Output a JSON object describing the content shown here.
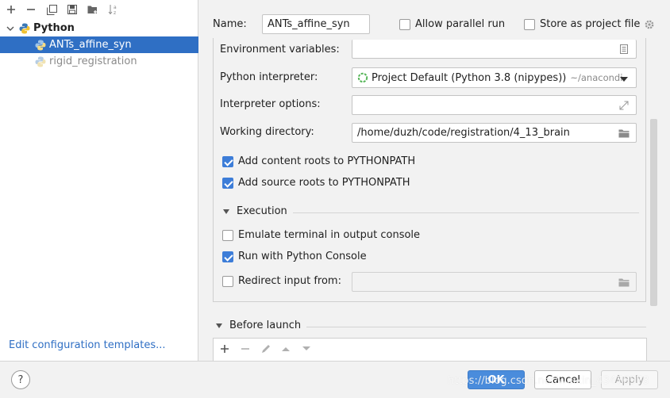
{
  "toolbar": {
    "add_icon": "plus-icon",
    "remove_icon": "minus-icon",
    "copy_icon": "copy-icon",
    "save_icon": "save-icon",
    "folder_icon": "new-folder-icon",
    "sort_icon": "sort-icon"
  },
  "tree": {
    "root_label": "Python",
    "items": [
      {
        "label": "ANTs_affine_syn",
        "selected": true
      },
      {
        "label": "rigid_registration",
        "selected": false
      }
    ]
  },
  "edit_templates_link": "Edit configuration templates...",
  "header": {
    "name_label": "Name:",
    "name_value": "ANTs_affine_syn",
    "allow_parallel_label": "Allow parallel run",
    "store_label": "Store as project file"
  },
  "config": {
    "env_label": "Environment variables:",
    "env_value": "",
    "interpreter_label": "Python interpreter:",
    "interpreter_value": "Project Default (Python 3.8 (nipypes))",
    "interpreter_path": "~/anacondi",
    "interp_options_label": "Interpreter options:",
    "interp_options_value": "",
    "workdir_label": "Working directory:",
    "workdir_value": "/home/duzh/code/registration/4_13_brain",
    "add_content_roots": "Add content roots to PYTHONPATH",
    "add_source_roots": "Add source roots to PYTHONPATH",
    "execution_label": "Execution",
    "emulate_terminal": "Emulate terminal in output console",
    "run_with_console": "Run with Python Console",
    "redirect_input": "Redirect input from:",
    "redirect_value": ""
  },
  "before_launch": {
    "label": "Before launch"
  },
  "buttons": {
    "help": "?",
    "ok": "OK",
    "cancel": "Cancel",
    "apply": "Apply"
  },
  "watermark": "https://blog.csdn.net/weixin_43476578",
  "colors": {
    "selection": "#2f6fc4",
    "checkbox_checked": "#3d7dd8",
    "primary_button": "#4a8cdc",
    "link": "#2f6fc4"
  }
}
